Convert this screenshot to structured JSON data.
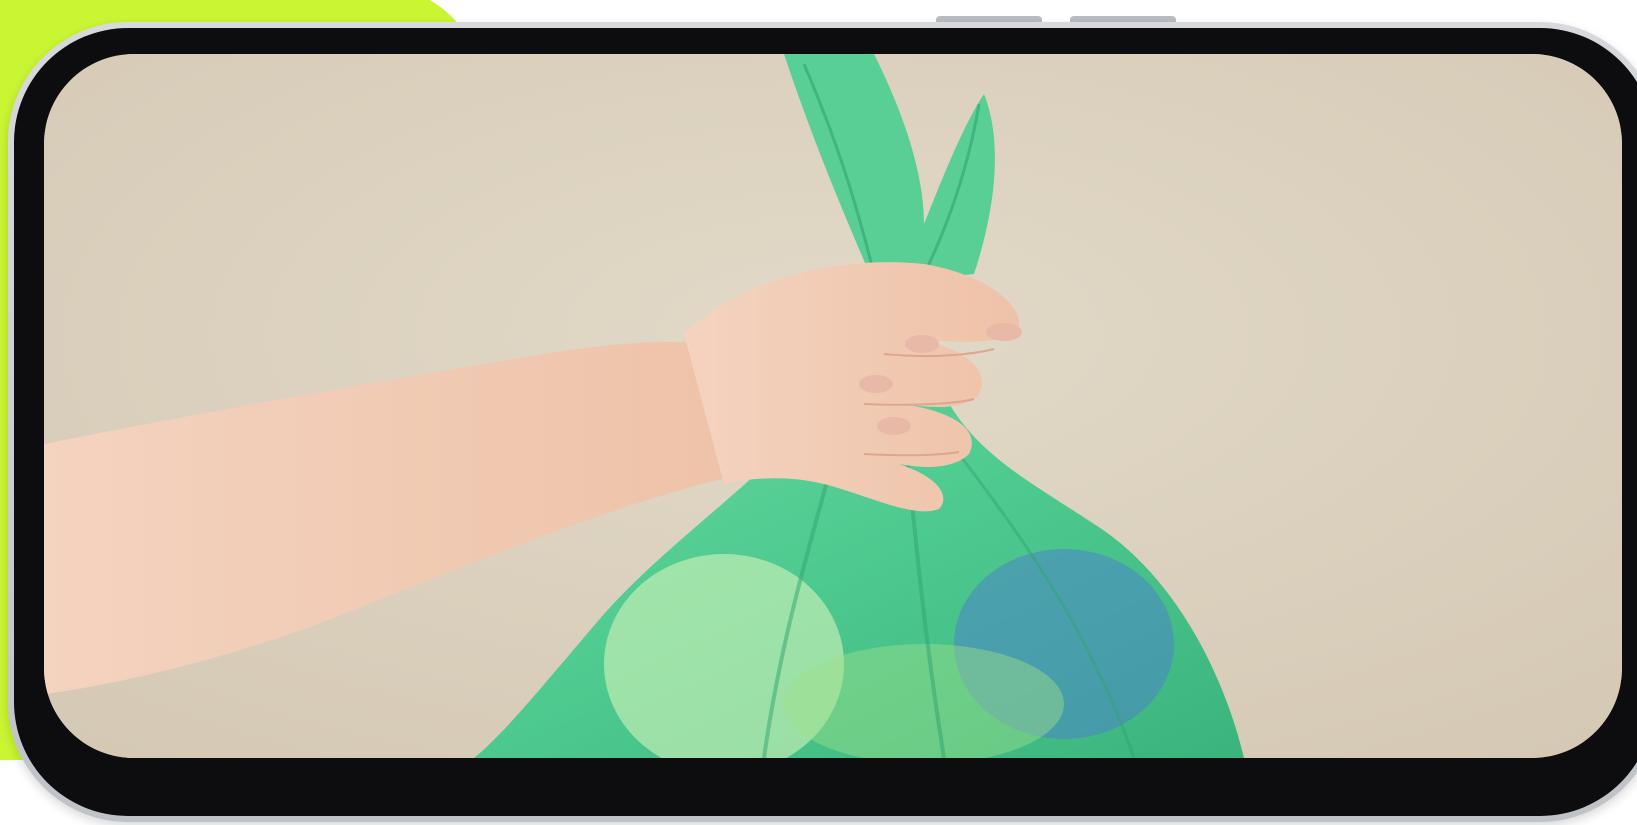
{
  "colors": {
    "accent": "#c9f533",
    "phone_frame": "#c4c7cc",
    "bezel": "#0d0d0f",
    "wall": "#ddd3c1",
    "bag_green": "#4fcf94",
    "skin": "#f2cdb6"
  },
  "image": {
    "subject": "hand-holding-green-trash-bag"
  }
}
